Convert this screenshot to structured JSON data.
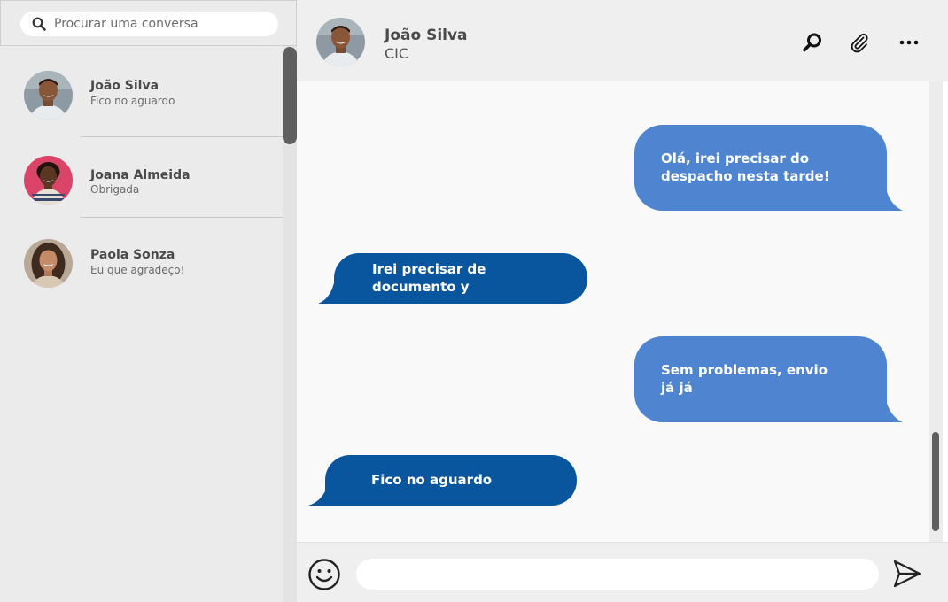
{
  "search": {
    "placeholder": "Procurar uma conversa"
  },
  "conversations": [
    {
      "name": "João Silva",
      "preview": "Fico no aguardo"
    },
    {
      "name": "Joana Almeida",
      "preview": "Obrigada"
    },
    {
      "name": "Paola Sonza",
      "preview": "Eu que agradeço!"
    }
  ],
  "chat": {
    "contact_name": "João Silva",
    "contact_subtitle": "CIC",
    "icons": {
      "search": "search-icon",
      "attach": "paperclip-icon",
      "more": "more-options-icon"
    },
    "messages": [
      {
        "direction": "outgoing",
        "lines": [
          "Olá, irei precisar do",
          "despacho nesta tarde!"
        ]
      },
      {
        "direction": "incoming",
        "lines": [
          "Irei precisar de",
          "documento y"
        ]
      },
      {
        "direction": "outgoing",
        "lines": [
          "Sem problemas, envio",
          "já já"
        ]
      },
      {
        "direction": "incoming",
        "lines": [
          "Fico no aguardo"
        ]
      }
    ]
  },
  "composer": {
    "value": "",
    "emoji_icon": "smiley-icon",
    "send_icon": "send-icon"
  },
  "colors": {
    "outgoing_bubble": "#4f84d0",
    "incoming_bubble": "#0a569e",
    "sidebar_bg": "#ebebeb"
  }
}
